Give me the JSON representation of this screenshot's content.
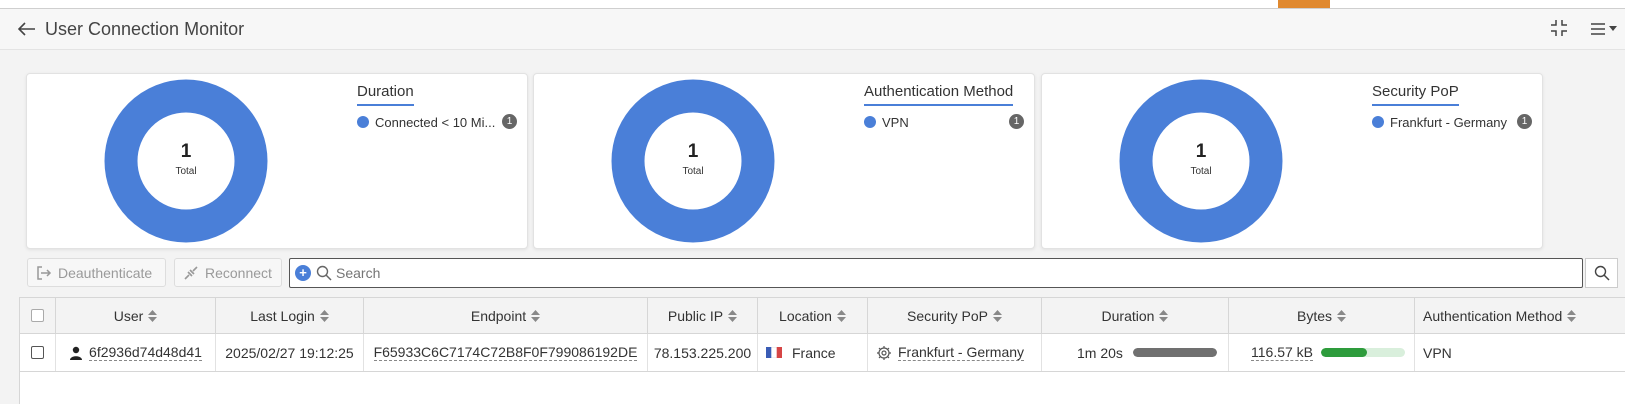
{
  "header": {
    "title": "User Connection Monitor"
  },
  "cards": [
    {
      "total_value": "1",
      "total_label": "Total",
      "legend_title": "Duration",
      "legend_item": "Connected < 10 Mi...",
      "count": "1",
      "color": "#4a7fd8"
    },
    {
      "total_value": "1",
      "total_label": "Total",
      "legend_title": "Authentication Method",
      "legend_item": "VPN",
      "count": "1",
      "color": "#4a7fd8"
    },
    {
      "total_value": "1",
      "total_label": "Total",
      "legend_title": "Security PoP",
      "legend_item": "Frankfurt - Germany",
      "count": "1",
      "color": "#4a7fd8"
    }
  ],
  "toolbar": {
    "deauth_label": "Deauthenticate",
    "reconnect_label": "Reconnect"
  },
  "search": {
    "placeholder": "Search",
    "value": ""
  },
  "table": {
    "columns": [
      "User",
      "Last Login",
      "Endpoint",
      "Public IP",
      "Location",
      "Security PoP",
      "Duration",
      "Bytes",
      "Authentication Method"
    ],
    "rows": [
      {
        "user": "6f2936d74d48d41",
        "last_login": "2025/02/27 19:12:25",
        "endpoint": "F65933C6C7174C72B8F0F799086192DE",
        "public_ip": "78.153.225.200",
        "location": "France",
        "security_pop": "Frankfurt - Germany",
        "duration": "1m 20s",
        "duration_fraction": 1.0,
        "bytes": "116.57 kB",
        "bytes_fraction": 0.55,
        "auth_method": "VPN"
      }
    ]
  },
  "colors": {
    "accent": "#e0892f",
    "chart": "#4a7fd8",
    "duration_bar": "#707070",
    "bytes_bar": "#2e9c3c",
    "bytes_bar_track": "#d9efdc"
  }
}
